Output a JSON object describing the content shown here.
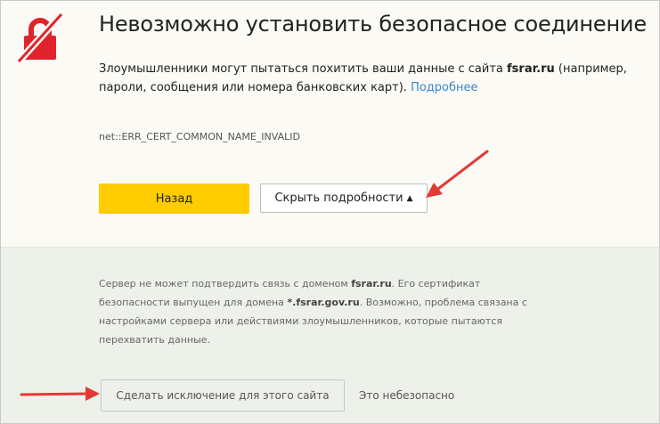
{
  "page": {
    "title": "Невозможно установить безопасное соединение",
    "description": {
      "prefix": "Злоумышленники могут пытаться похитить ваши данные с сайта ",
      "site": "fsrar.ru",
      "suffix": " (например, пароли, сообщения или номера банковских карт). ",
      "link_label": "Подробнее"
    },
    "error_code": "net::ERR_CERT_COMMON_NAME_INVALID",
    "lock_icon": "broken-lock-icon",
    "lock_color": "#e0242b"
  },
  "buttons": {
    "back_label": "Назад",
    "back_color": "#ffcc00",
    "hide_details_label": "Скрыть подробности",
    "hide_details_icon": "caret-up-icon",
    "hide_details_caret": "▲"
  },
  "details": {
    "part1": "Сервер не может подтвердить связь с доменом ",
    "domain": "fsrar.ru",
    "part2": ". Его сертификат безопасности выпущен для домена ",
    "cert_domain": "*.fsrar.gov.ru",
    "part3": ". Возможно, проблема связана с настройками сервера или действиями злоумышленников, которые пытаются перехватить данные.",
    "exception_button_label": "Сделать исключение для этого сайта",
    "unsafe_label": "Это небезопасно"
  },
  "annotations": {
    "arrow_color": "#e53935"
  }
}
